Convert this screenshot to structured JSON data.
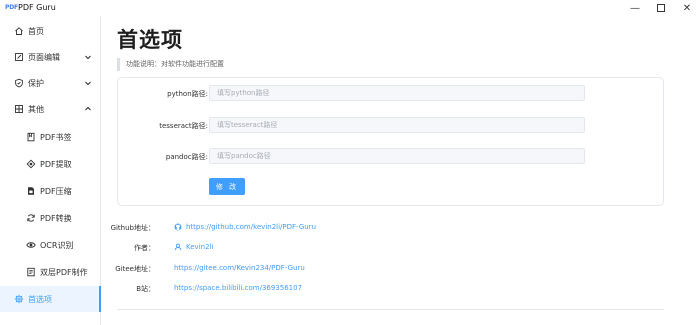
{
  "window": {
    "logo_text": "PDF",
    "title": "PDF Guru",
    "minimize_glyph": "—",
    "close_glyph": "✕"
  },
  "sidebar": {
    "items": [
      {
        "label": "首页",
        "icon": "home-icon"
      },
      {
        "label": "页面编辑",
        "icon": "edit-icon",
        "expandable": true,
        "expanded": false
      },
      {
        "label": "保护",
        "icon": "shield-icon",
        "expandable": true,
        "expanded": false
      },
      {
        "label": "其他",
        "icon": "grid-icon",
        "expandable": true,
        "expanded": true
      }
    ],
    "sub_items": [
      {
        "label": "PDF书签",
        "icon": "bookmark-icon"
      },
      {
        "label": "PDF提取",
        "icon": "target-icon"
      },
      {
        "label": "PDF压缩",
        "icon": "compress-icon"
      },
      {
        "label": "PDF转换",
        "icon": "refresh-icon"
      },
      {
        "label": "OCR识别",
        "icon": "eye-icon"
      },
      {
        "label": "双层PDF制作",
        "icon": "layers-icon"
      }
    ],
    "active_item": {
      "label": "首选项",
      "icon": "gear-icon"
    }
  },
  "main": {
    "title": "首选项",
    "description": "功能说明：对软件功能进行配置",
    "form": {
      "fields": [
        {
          "label": "python路径:",
          "value": "",
          "placeholder": "填写python路径"
        },
        {
          "label": "tesseract路径:",
          "value": "",
          "placeholder": "填写tesseract路径"
        },
        {
          "label": "pandoc路径:",
          "value": "",
          "placeholder": "填写pandoc路径"
        }
      ],
      "submit_label": "修 改"
    },
    "info": [
      {
        "label": "Github地址：",
        "value": "https://github.com/kevin2li/PDF-Guru",
        "icon": "github-icon"
      },
      {
        "label": "作者：",
        "value": "Kevin2li",
        "icon": "user-icon"
      },
      {
        "label": "Gitee地址：",
        "value": "https://gitee.com/Kevin234/PDF-Guru",
        "icon": ""
      },
      {
        "label": "B站：",
        "value": "https://space.bilibili.com/369356107",
        "icon": ""
      }
    ]
  },
  "colors": {
    "accent": "#409eff",
    "active_bg": "#ecf5ff",
    "border": "#e4e7ed",
    "input_bg": "#f5f7fa"
  }
}
